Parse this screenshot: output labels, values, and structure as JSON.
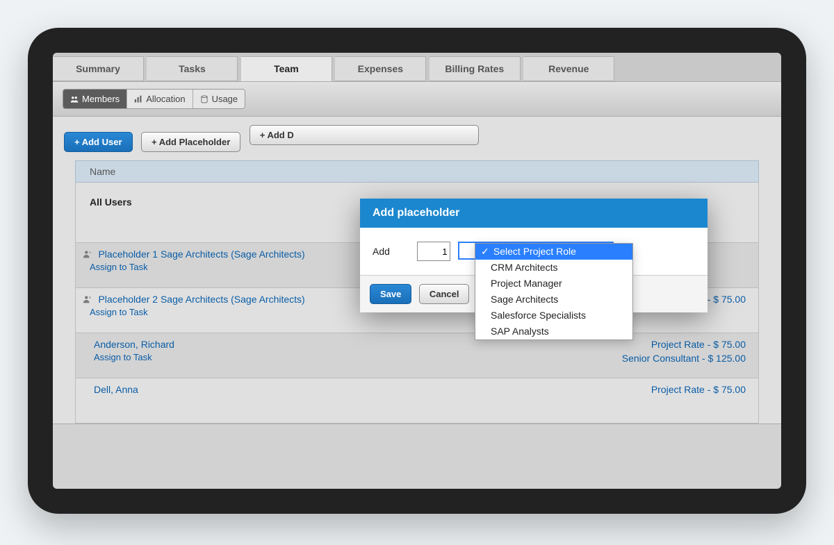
{
  "tabs": [
    "Summary",
    "Tasks",
    "Team",
    "Expenses",
    "Billing Rates",
    "Revenue"
  ],
  "subnav": [
    "Members",
    "Allocation",
    "Usage"
  ],
  "actions": {
    "add_user": "+ Add User",
    "add_placeholder": "+ Add Placeholder",
    "add_department_truncated": "+ Add D"
  },
  "grid": {
    "header_name": "Name",
    "assign_task": "Assign to Task",
    "rows": [
      {
        "label": "All Users"
      },
      {
        "label": "Placeholder 1 Sage Architects (Sage Architects)"
      },
      {
        "label": "Placeholder 2 Sage Architects (Sage Architects)",
        "rate": "Project Rate - $ 75.00"
      },
      {
        "label": "Anderson, Richard",
        "rate": "Project Rate - $ 75.00",
        "rate2": "Senior Consultant - $ 125.00"
      },
      {
        "label": "Dell, Anna",
        "rate": "Project Rate - $ 75.00"
      }
    ]
  },
  "modal": {
    "title": "Add placeholder",
    "add_label": "Add",
    "quantity": "1",
    "options": [
      "Select Project Role",
      "CRM Architects",
      "Project Manager",
      "Sage Architects",
      "Salesforce Specialists",
      "SAP Analysts"
    ],
    "save": "Save",
    "cancel": "Cancel"
  }
}
